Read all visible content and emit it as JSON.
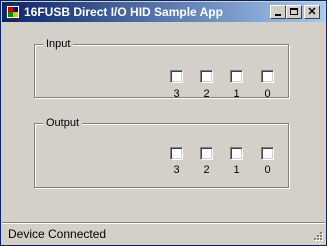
{
  "window": {
    "title": "16FUSB Direct I/O HID Sample App",
    "controls": [
      "minimize-icon",
      "maximize-icon",
      "close-icon"
    ],
    "close_glyph": "✕"
  },
  "input_group": {
    "label": "Input",
    "bits": [
      {
        "label": "3",
        "checked": false
      },
      {
        "label": "2",
        "checked": false
      },
      {
        "label": "1",
        "checked": false
      },
      {
        "label": "0",
        "checked": false
      }
    ]
  },
  "output_group": {
    "label": "Output",
    "bits": [
      {
        "label": "3",
        "checked": false
      },
      {
        "label": "2",
        "checked": false
      },
      {
        "label": "1",
        "checked": false
      },
      {
        "label": "0",
        "checked": false
      }
    ]
  },
  "status_bar": {
    "text": "Device Connected"
  },
  "colors": {
    "titlebar_start": "#0a246a",
    "titlebar_end": "#a6caf0",
    "face": "#d4d0c8"
  }
}
